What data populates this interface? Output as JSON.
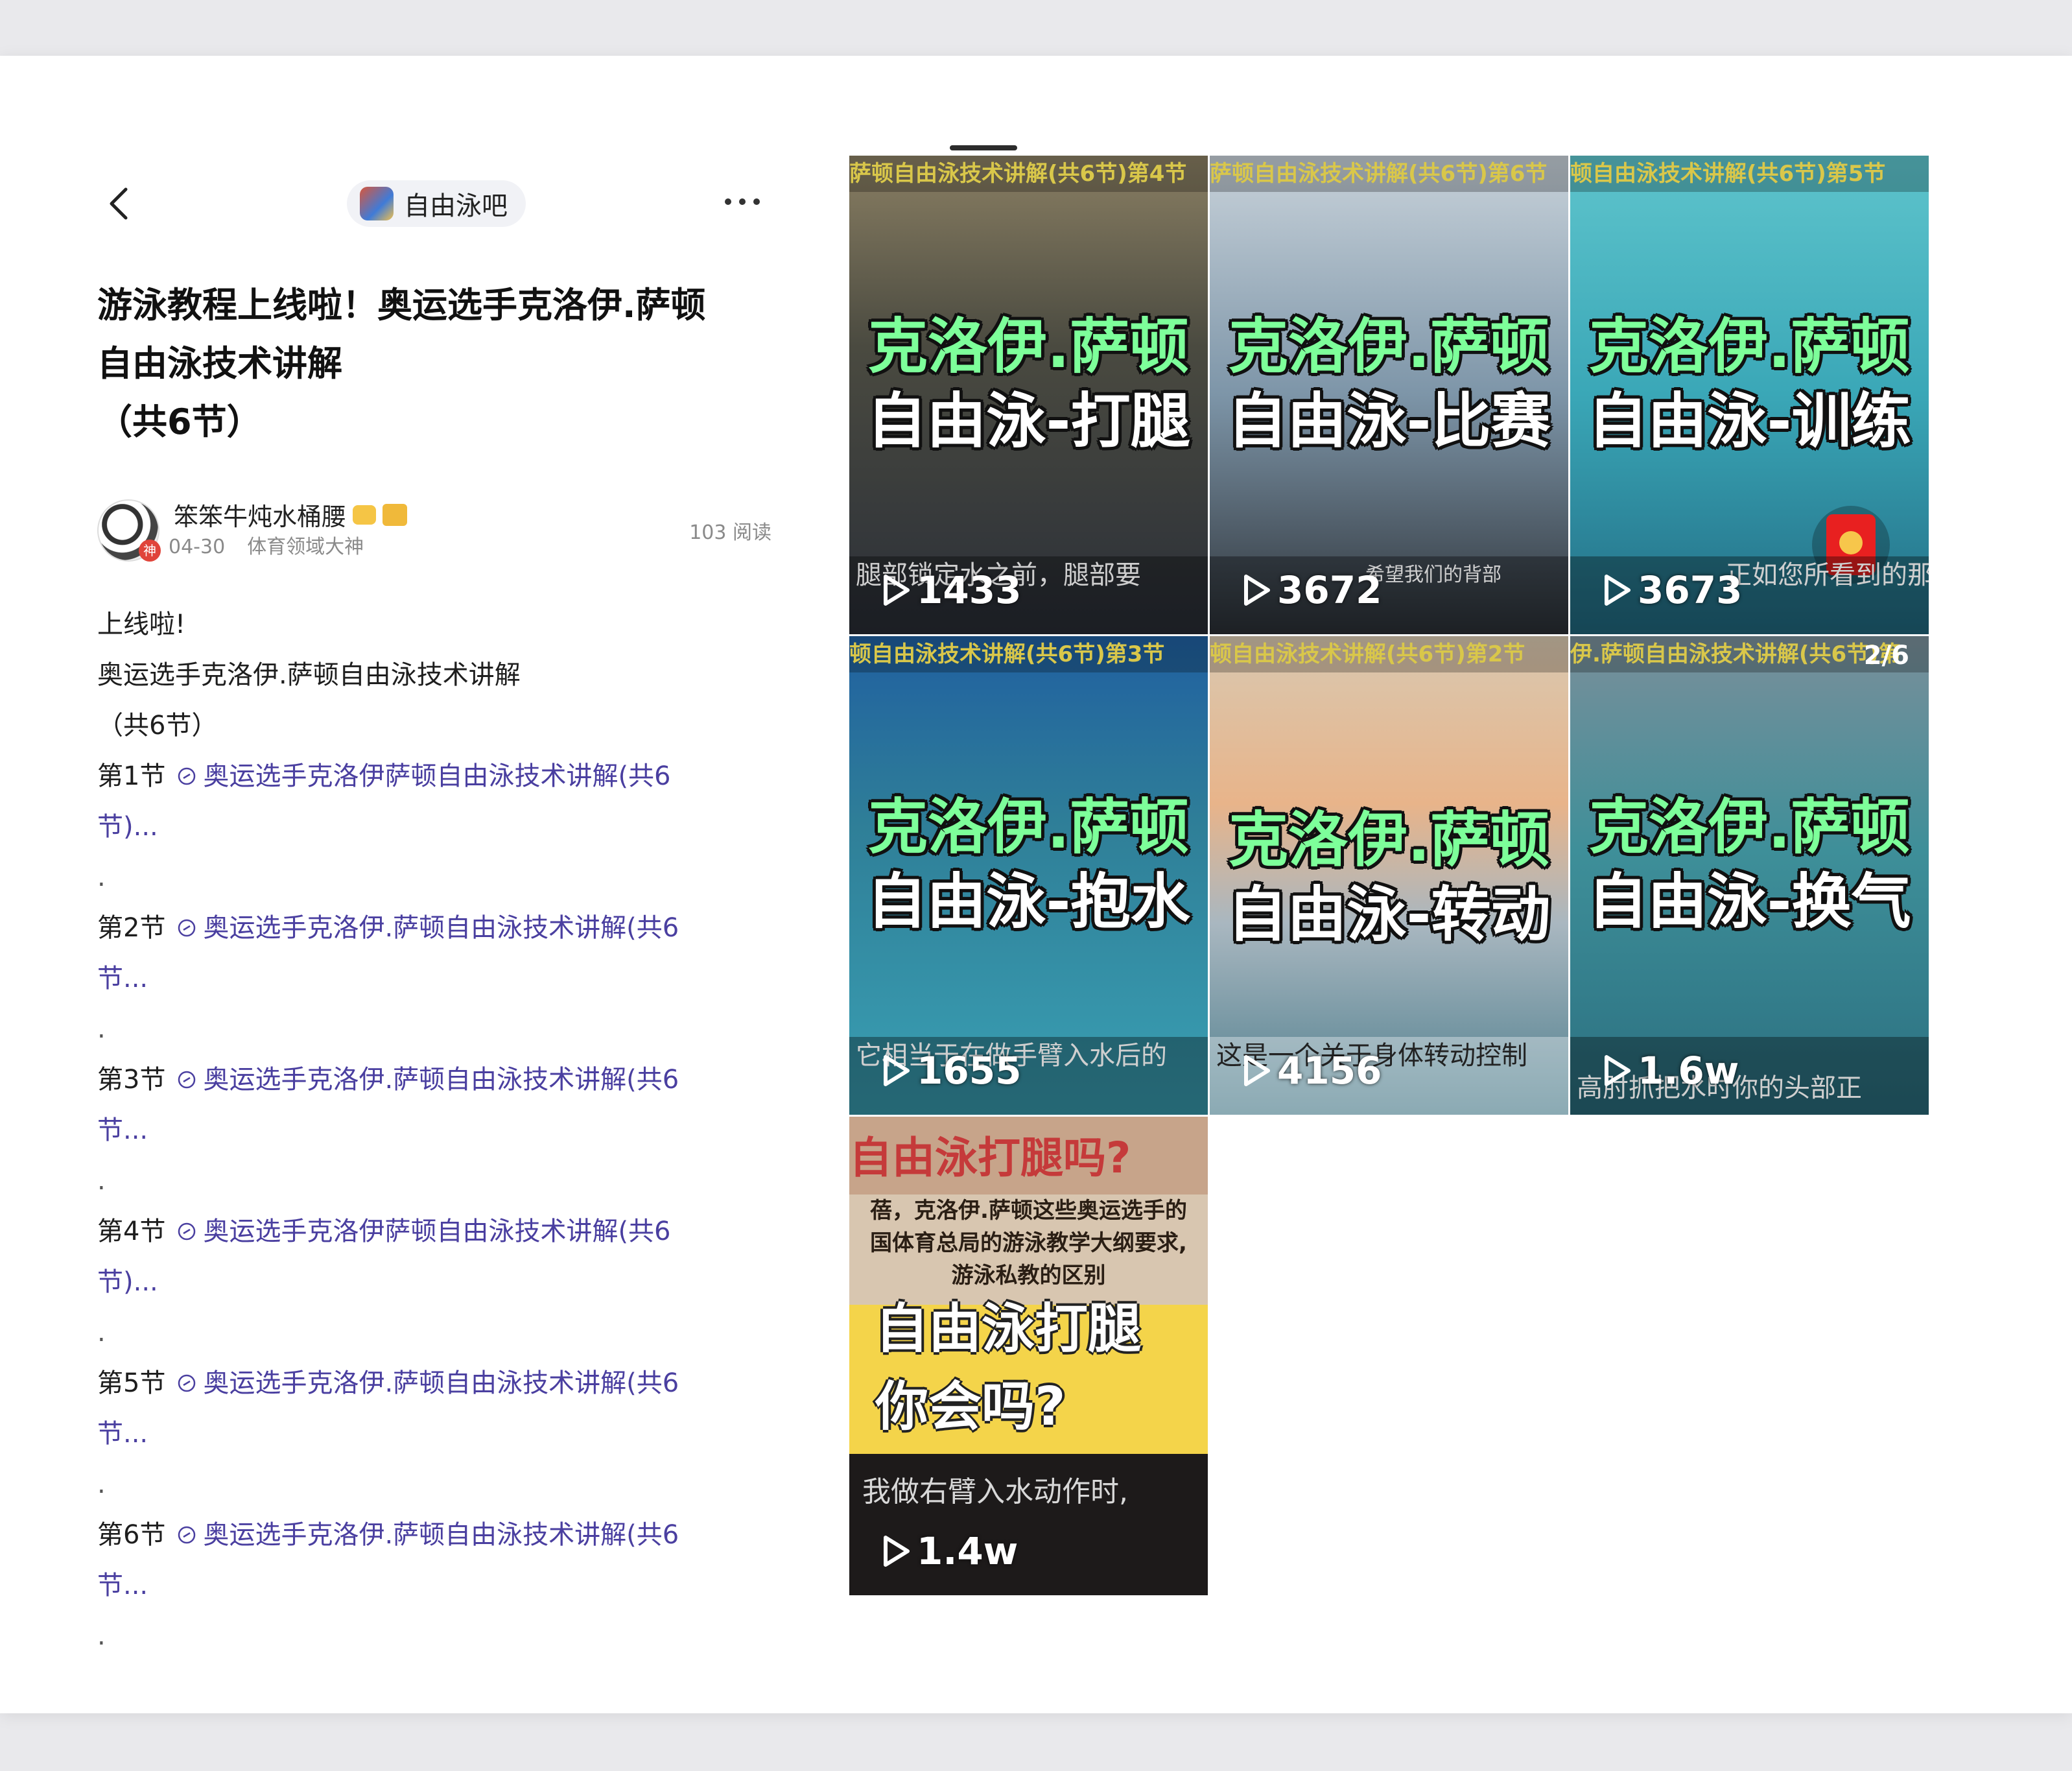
{
  "header": {
    "forum_name": "自由泳吧"
  },
  "post": {
    "title_lines": [
      "游泳教程上线啦！奥运选手克洛伊.萨顿",
      "自由泳技术讲解",
      "（共6节）"
    ],
    "author": {
      "name": "笨笨牛炖水桶腰",
      "badge": "神",
      "date": "04-30",
      "tag": "体育领域大神",
      "reads": "103 阅读"
    },
    "body": {
      "intro": [
        "上线啦!",
        "奥运选手克洛伊.萨顿自由泳技术讲解",
        "（共6节）"
      ],
      "dot": ".",
      "sections": [
        {
          "label": "第1节",
          "link_l1": "奥运选手克洛伊萨顿自由泳技术讲解(共6",
          "link_l2": "节)..."
        },
        {
          "label": "第2节",
          "link_l1": "奥运选手克洛伊.萨顿自由泳技术讲解(共6",
          "link_l2": "节..."
        },
        {
          "label": "第3节",
          "link_l1": "奥运选手克洛伊.萨顿自由泳技术讲解(共6",
          "link_l2": "节..."
        },
        {
          "label": "第4节",
          "link_l1": "奥运选手克洛伊萨顿自由泳技术讲解(共6",
          "link_l2": "节)..."
        },
        {
          "label": "第5节",
          "link_l1": "奥运选手克洛伊.萨顿自由泳技术讲解(共6",
          "link_l2": "节..."
        },
        {
          "label": "第6节",
          "link_l1": "奥运选手克洛伊.萨顿自由泳技术讲解(共6",
          "link_l2": "节..."
        }
      ]
    }
  },
  "gallery": {
    "tiles": [
      {
        "caption": "萨顿自由泳技术讲解(共6节)第4节",
        "title_top": "克洛伊.萨顿",
        "title_bottom": "自由泳-打腿",
        "subtitle": "腿部锁定水之前，腿部要",
        "plays": "1433",
        "bg": "#4a4a40"
      },
      {
        "caption": "萨顿自由泳技术讲解(共6节)第6节",
        "title_top": "克洛伊.萨顿",
        "title_bottom": "自由泳-比赛",
        "subtitle": "希望我们的背部",
        "plays": "3672",
        "bg": "#7d95a8"
      },
      {
        "caption": "顿自由泳技术讲解(共6节)第5节",
        "title_top": "克洛伊.萨顿",
        "title_bottom": "自由泳-训练",
        "subtitle": "正如您所看到的那样，",
        "plays": "3673",
        "bg": "#3aa7b7"
      },
      {
        "caption": "顿自由泳技术讲解(共6节)第3节",
        "title_top": "克洛伊.萨顿",
        "title_bottom": "自由泳-抱水",
        "subtitle": "它相当于在做手臂入水后的",
        "plays": "1655",
        "bg": "#2f7f98"
      },
      {
        "caption": "顿自由泳技术讲解(共6节)第2节",
        "title_top": "克洛伊.萨顿",
        "title_bottom": "自由泳-转动",
        "subtitle": "这是一个关于身体转动控制",
        "plays": "4156",
        "bg": "#a9b7c0"
      },
      {
        "caption": "伊.萨顿自由泳技术讲解(共6节)第",
        "title_top": "克洛伊.萨顿",
        "title_bottom": "自由泳-换气",
        "subtitle": "高肘抓把水时你的头部正",
        "plays": "1.6w",
        "bg": "#3e8f99",
        "pager": "2/6"
      },
      {
        "caption": "自由泳打腿吗?",
        "text_block": [
          "蓓，克洛伊.萨顿这些奥运选手的",
          "国体育总局的游泳教学大纲要求,",
          "游泳私教的区别"
        ],
        "hand_1": "自由泳打腿",
        "hand_2": "你会吗?",
        "subtitle": "我做右臂入水动作时,",
        "plays": "1.4w"
      }
    ]
  }
}
